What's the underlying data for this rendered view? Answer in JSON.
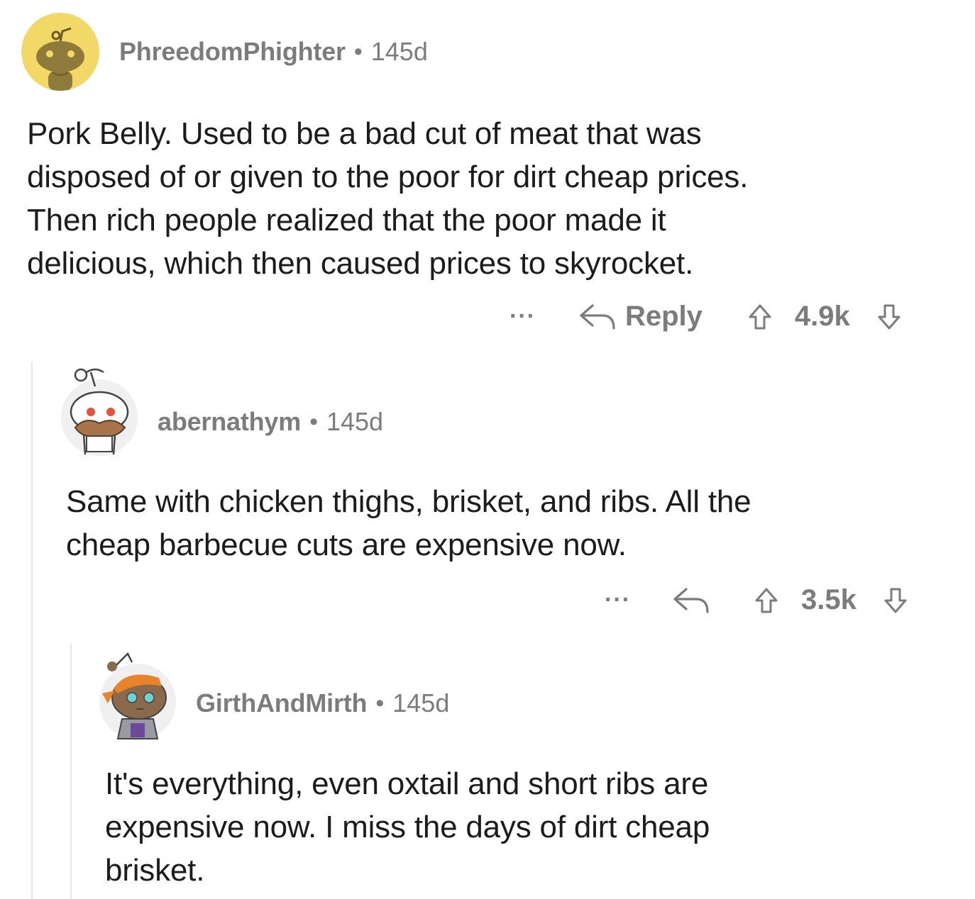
{
  "comments": [
    {
      "username": "PhreedomPhighter",
      "separator": "•",
      "age": "145d",
      "avatar_icon": "snoo-avatar-icon",
      "body_lines": [
        "Pork Belly. Used to be a bad cut of meat that was",
        "disposed of or given to the poor for dirt cheap prices.",
        "Then rich people realized that the poor made it",
        "delicious, which then caused prices to skyrocket."
      ],
      "more_label": "···",
      "reply_label": "Reply",
      "score": "4.9k"
    },
    {
      "username": "abernathym",
      "separator": "•",
      "age": "145d",
      "avatar_icon": "snoo-chef-avatar-icon",
      "body_lines": [
        "Same with chicken thighs, brisket, and ribs. All the",
        "cheap barbecue cuts are expensive now."
      ],
      "more_label": "···",
      "score": "3.5k"
    },
    {
      "username": "GirthAndMirth",
      "separator": "•",
      "age": "145d",
      "avatar_icon": "snoo-bandana-avatar-icon",
      "body_lines": [
        "It's everything, even oxtail and short ribs are",
        "expensive now. I miss the days of dirt cheap",
        "brisket."
      ]
    }
  ],
  "colors": {
    "meta_text": "#7c7c7c",
    "body_text": "#1c1c1c",
    "thread_line": "#e6e6e6",
    "avatar_yellow": "#f2d867"
  }
}
